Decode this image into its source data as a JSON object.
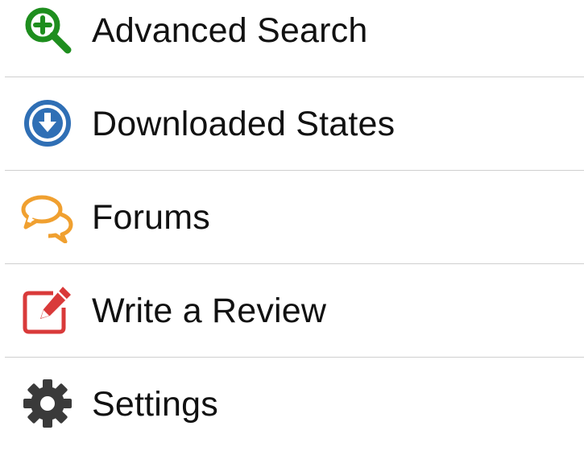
{
  "menu": {
    "items": [
      {
        "label": "Advanced Search",
        "icon": "search-plus-icon",
        "color": "#1e8e1e"
      },
      {
        "label": "Downloaded States",
        "icon": "download-circle-icon",
        "color": "#2f6fb5"
      },
      {
        "label": "Forums",
        "icon": "chat-bubbles-icon",
        "color": "#f0a030"
      },
      {
        "label": "Write a Review",
        "icon": "edit-icon",
        "color": "#d93a3a"
      },
      {
        "label": "Settings",
        "icon": "gear-icon",
        "color": "#3a3a3a"
      }
    ]
  }
}
